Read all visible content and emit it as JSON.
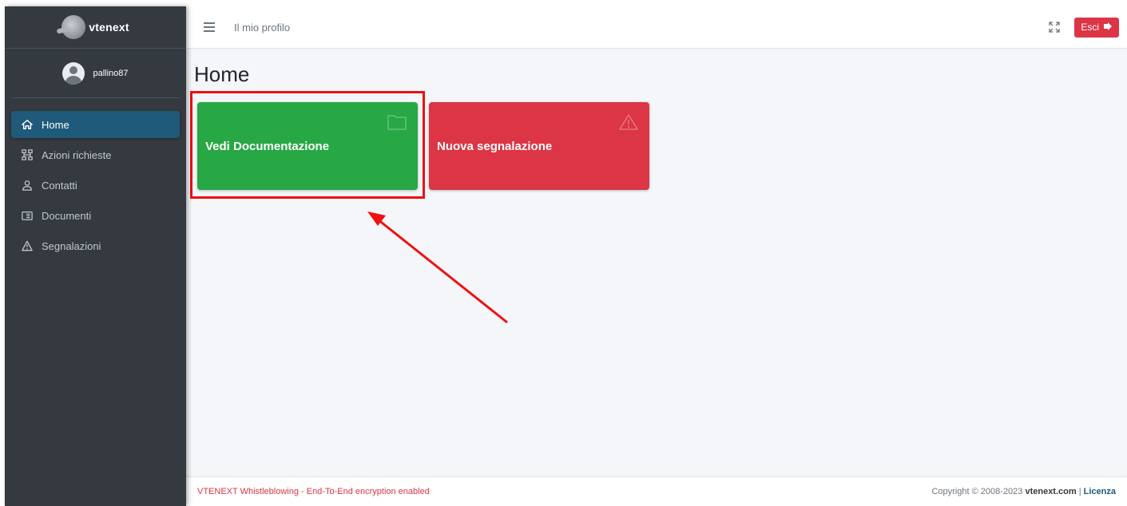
{
  "brand": {
    "name": "vtenext"
  },
  "user": {
    "username": "pallino87"
  },
  "sidebar": {
    "items": [
      {
        "label": "Home",
        "icon": "home-icon",
        "active": true
      },
      {
        "label": "Azioni richieste",
        "icon": "sitemap-icon",
        "active": false
      },
      {
        "label": "Contatti",
        "icon": "user-icon",
        "active": false
      },
      {
        "label": "Documenti",
        "icon": "folder-doc-icon",
        "active": false
      },
      {
        "label": "Segnalazioni",
        "icon": "warning-icon",
        "active": false
      }
    ]
  },
  "header": {
    "profile_link": "Il mio profilo",
    "logout_label": "Esci"
  },
  "main": {
    "title": "Home",
    "cards": [
      {
        "label": "Vedi Documentazione",
        "icon": "folder-icon",
        "color": "#28a745"
      },
      {
        "label": "Nuova segnalazione",
        "icon": "warning-icon",
        "color": "#dc3545"
      }
    ]
  },
  "footer": {
    "left_text": "VTENEXT Whistleblowing - End-To-End encryption enabled",
    "copyright": "Copyright © 2008-2023",
    "site": "vtenext.com",
    "separator": "|",
    "license": "Licenza"
  },
  "colors": {
    "sidebar_bg": "#343a40",
    "active_item": "#1f5a7a",
    "success": "#28a745",
    "danger": "#dc3545",
    "annotation": "#ee1111"
  }
}
